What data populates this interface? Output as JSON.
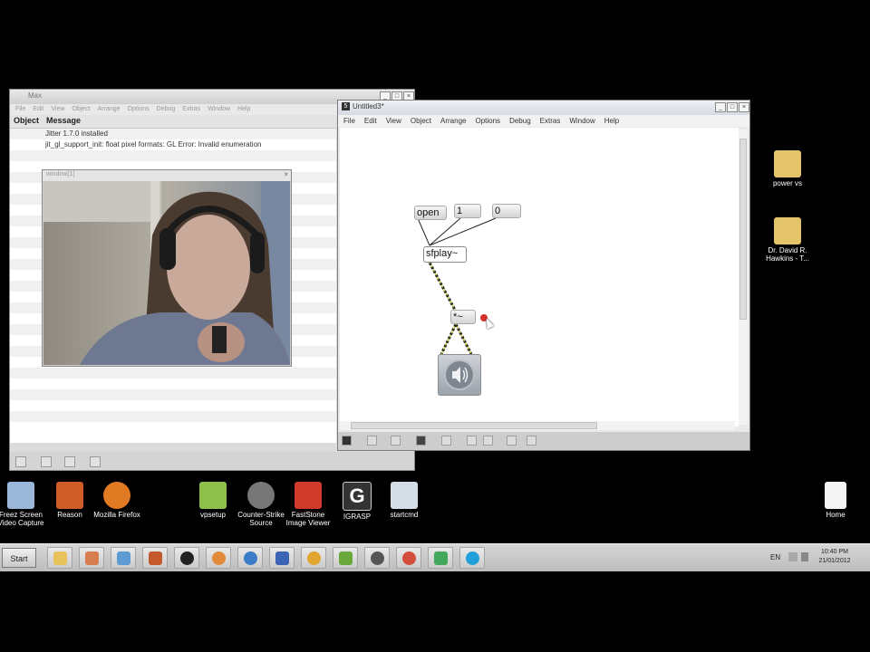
{
  "max_window": {
    "title": "Max",
    "menu": [
      "File",
      "Edit",
      "View",
      "Object",
      "Arrange",
      "Options",
      "Debug",
      "Extras",
      "Window",
      "Help"
    ],
    "columns": [
      "Object",
      "Message"
    ],
    "messages": [
      "Jitter 1.7.0 installed",
      "jit_gl_support_init: float pixel formats: GL Error: Invalid enumeration"
    ]
  },
  "webcam_window": {
    "title": "window[1]"
  },
  "patcher": {
    "title": "Untitled3*",
    "menu": [
      "File",
      "Edit",
      "View",
      "Object",
      "Arrange",
      "Options",
      "Debug",
      "Extras",
      "Window",
      "Help"
    ],
    "objects": {
      "open": "open",
      "one": "1",
      "zero": "0",
      "sfplay": "sfplay~",
      "mult": "*~"
    }
  },
  "desktop_icons": [
    {
      "label": "power vs",
      "color": "#e3c46a"
    },
    {
      "label": "Dr. David R.\nHawkins - T...",
      "color": "#e3c46a"
    },
    {
      "label": "Freez Screen\nVideo Capture",
      "color": "#9ab6d8"
    },
    {
      "label": "Reason",
      "color": "#cf5b27"
    },
    {
      "label": "Mozilla Firefox",
      "color": "#e07a23"
    },
    {
      "label": "vpsetup",
      "color": "#8cc04a"
    },
    {
      "label": "Counter-Strike\nSource",
      "color": "#777777"
    },
    {
      "label": "FastStone\nImage Viewer",
      "color": "#d03a2a"
    },
    {
      "label": "IGRASP",
      "color": "#333333"
    },
    {
      "label": "startcmd",
      "color": "#d5dde6"
    },
    {
      "label": "Home",
      "color": "#f4f4f4"
    }
  ],
  "taskbar": {
    "start_label": "Start",
    "apps": [
      {
        "icon": "folder-icon",
        "color": "#e8c25a"
      },
      {
        "icon": "paint-icon",
        "color": "#d77d4f"
      },
      {
        "icon": "network-icon",
        "color": "#5e9bd4"
      },
      {
        "icon": "reason-icon",
        "color": "#c45a2c"
      },
      {
        "icon": "max-icon",
        "color": "#222222"
      },
      {
        "icon": "settings-icon",
        "color": "#e08a3a"
      },
      {
        "icon": "media-icon",
        "color": "#3a7cc7"
      },
      {
        "icon": "floppy-icon",
        "color": "#3d63b5"
      },
      {
        "icon": "headphones-icon",
        "color": "#e1a530"
      },
      {
        "icon": "chart-icon",
        "color": "#6aa83c"
      },
      {
        "icon": "player-icon",
        "color": "#555555"
      },
      {
        "icon": "chrome-icon",
        "color": "#d24d3b"
      },
      {
        "icon": "chat-icon",
        "color": "#43a85b"
      },
      {
        "icon": "skype-icon",
        "color": "#1fa0db"
      }
    ],
    "language": "EN",
    "time": "10:40 PM",
    "date": "21/01/2012"
  }
}
